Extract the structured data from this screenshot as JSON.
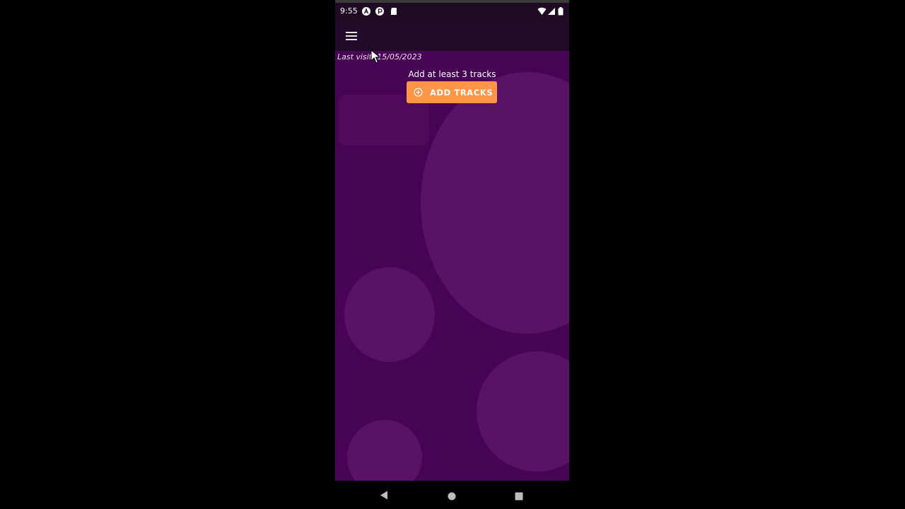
{
  "status_bar": {
    "time": "9:55"
  },
  "app_bar": {
    "menu_icon": "hamburger-menu-icon"
  },
  "content": {
    "last_visit": "Last visit: 15/05/2023",
    "add_hint": "Add at least 3 tracks",
    "add_tracks_label": "ADD TRACKS",
    "add_tracks_icon": "add-circle-icon"
  },
  "colors": {
    "background": "#470455",
    "bubble": "#5a1266",
    "accent": "#ff9548",
    "app_bar": "#230a2a"
  },
  "nav_bar": {
    "back_icon": "back-triangle-icon",
    "home_icon": "home-circle-icon",
    "recents_icon": "recents-square-icon"
  }
}
